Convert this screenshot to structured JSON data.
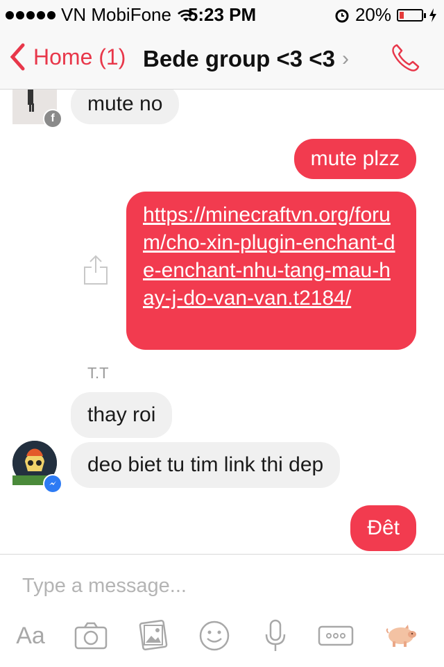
{
  "status": {
    "carrier": "VN MobiFone",
    "time": "5:23 PM",
    "battery": "20%",
    "battery_level": 0.2,
    "signal_dots": 5
  },
  "nav": {
    "back_label": "Home (1)",
    "title": "Bede group <3 <3",
    "title_chevron": "›"
  },
  "messages": [
    {
      "direction": "incoming",
      "text": "mute no",
      "avatar_badge": "facebook"
    },
    {
      "direction": "outgoing",
      "text": "mute plzz"
    },
    {
      "direction": "outgoing",
      "text": "https://minecraftvn.org/forum/cho-xin-plugin-enchant-de-enchant-nhu-tang-mau-hay-j-do-van-van.t2184/",
      "type": "link"
    },
    {
      "sender": "T.T",
      "direction": "incoming",
      "text": "thay roi"
    },
    {
      "direction": "incoming",
      "text": "deo biet tu tim link thi dep",
      "avatar_badge": "messenger"
    },
    {
      "direction": "outgoing",
      "text": "Đêt"
    }
  ],
  "composer": {
    "placeholder": "Type a message...",
    "tools": [
      {
        "name": "text-format",
        "label": "Aa"
      },
      {
        "name": "camera-icon"
      },
      {
        "name": "gallery-icon"
      },
      {
        "name": "emoji-icon"
      },
      {
        "name": "microphone-icon"
      },
      {
        "name": "more-icon"
      },
      {
        "name": "pig-sticker-icon"
      }
    ]
  },
  "colors": {
    "accent": "#e8374a",
    "outgoing_bubble": "#f23b4f",
    "incoming_bubble": "#f0f0f0",
    "messenger_badge": "#2d7bf4"
  }
}
